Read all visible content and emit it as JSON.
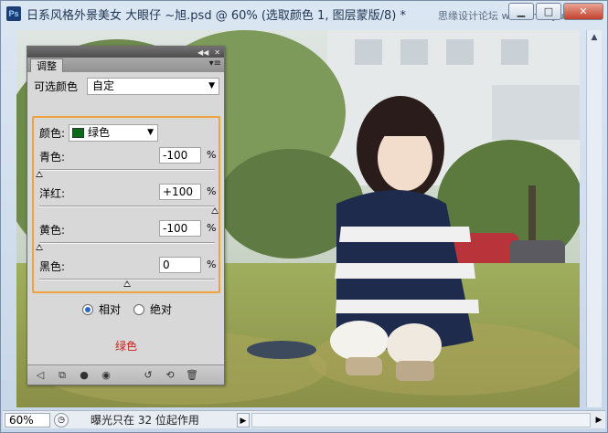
{
  "window": {
    "app_icon": "Ps",
    "title": "日系风格外景美女  大眼仔 ~旭.psd @ 60% (选取颜色 1, 图层蒙版/8) *",
    "watermark": "思缘设计论坛 www.missyuan.com",
    "minimize_icon": "minimize-icon",
    "maximize_icon": "maximize-icon",
    "close_icon": "close-icon"
  },
  "panel": {
    "tab_label": "调整",
    "preset_label": "可选颜色",
    "preset_value": "自定",
    "colors_label": "颜色:",
    "colors_value": "绿色",
    "swatch_color": "#0d6b1a",
    "sliders": [
      {
        "label": "青色:",
        "value": "-100",
        "unit": "%",
        "level": 0
      },
      {
        "label": "洋红:",
        "value": "+100",
        "unit": "%",
        "level": 1
      },
      {
        "label": "黄色:",
        "value": "-100",
        "unit": "%",
        "level": 0
      },
      {
        "label": "黑色:",
        "value": "0",
        "unit": "%",
        "level": 0.5
      }
    ],
    "method_relative": "相对",
    "method_absolute": "绝对",
    "selected_method": "relative",
    "note": "绿色",
    "note_color": "#d02020",
    "highlight_color": "#f0a33a"
  },
  "status": {
    "zoom": "60%",
    "message": "曝光只在 32 位起作用"
  }
}
